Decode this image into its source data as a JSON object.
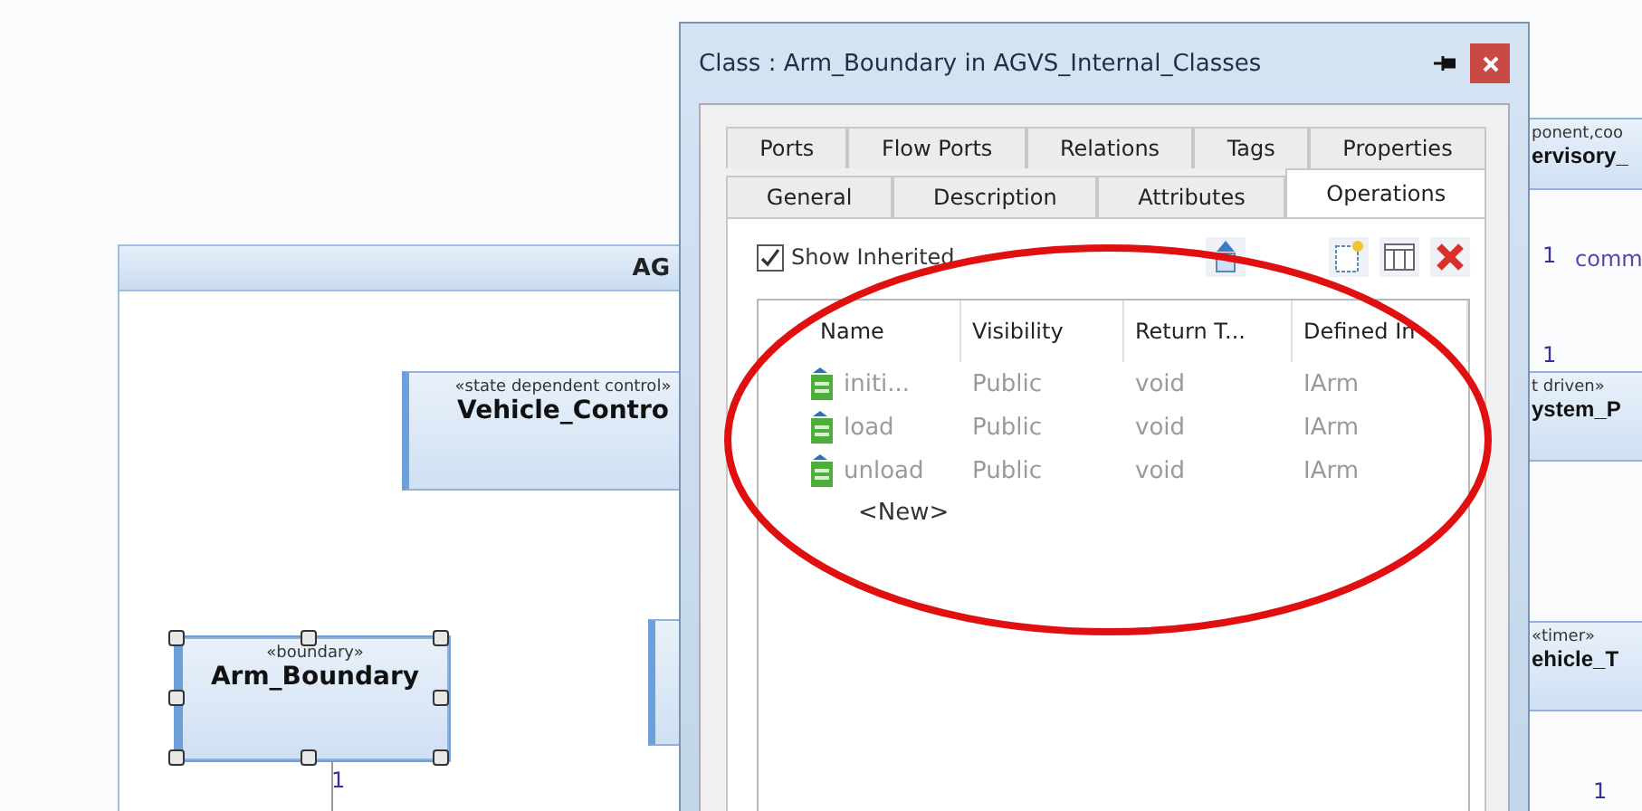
{
  "diagram": {
    "frame_title": "AG",
    "nodes": [
      {
        "stereotype": "«state dependent control»",
        "name": "Vehicle_Contro",
        "selected": false
      },
      {
        "stereotype": "«boundary»",
        "name": "Arm_Boundary",
        "selected": true
      },
      {
        "stereotype": "ponent,coo",
        "name": "ervisory_",
        "selected": false
      },
      {
        "stereotype": "t driven»",
        "name": "ystem_P",
        "selected": false
      },
      {
        "stereotype": "«timer»",
        "name": "ehicle_T",
        "selected": false
      }
    ],
    "labels": [
      {
        "text": "1",
        "kind": "multiplicity"
      },
      {
        "text": "1",
        "kind": "multiplicity"
      },
      {
        "text": "comm",
        "kind": "role"
      },
      {
        "text": "1",
        "kind": "multiplicity"
      },
      {
        "text": "1",
        "kind": "multiplicity"
      }
    ]
  },
  "dialog": {
    "title": "Class : Arm_Boundary in AGVS_Internal_Classes",
    "tab_rows": [
      [
        {
          "label": "Ports",
          "selected": false
        },
        {
          "label": "Flow Ports",
          "selected": false
        },
        {
          "label": "Relations",
          "selected": false
        },
        {
          "label": "Tags",
          "selected": false
        },
        {
          "label": "Properties",
          "selected": false
        }
      ],
      [
        {
          "label": "General",
          "selected": false
        },
        {
          "label": "Description",
          "selected": false
        },
        {
          "label": "Attributes",
          "selected": false
        },
        {
          "label": "Operations",
          "selected": true
        }
      ]
    ],
    "show_inherited": {
      "label": "Show Inherited",
      "checked": true
    },
    "table": {
      "columns": [
        "Name",
        "Visibility",
        "Return T...",
        "Defined In"
      ],
      "rows": [
        {
          "cells": [
            "initi...",
            "Public",
            "void",
            "IArm"
          ],
          "inherited": true
        },
        {
          "cells": [
            "load",
            "Public",
            "void",
            "IArm"
          ],
          "inherited": true
        },
        {
          "cells": [
            "unload",
            "Public",
            "void",
            "IArm"
          ],
          "inherited": true
        }
      ],
      "new_row": "<New>"
    }
  }
}
